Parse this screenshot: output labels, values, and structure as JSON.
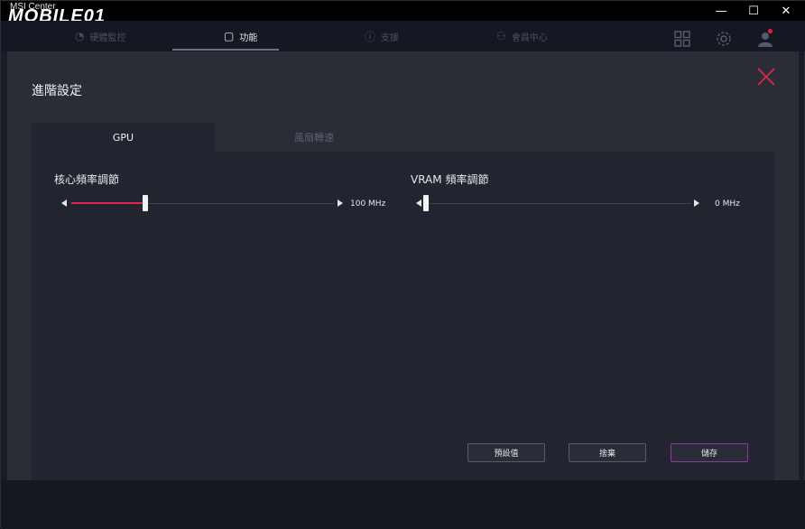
{
  "app": {
    "title": "MSI Center",
    "brand": "MOBILE01"
  },
  "window_controls": {
    "minimize": "—",
    "maximize": "☐",
    "close": "✕"
  },
  "nav": {
    "tabs": [
      {
        "label": "硬體監控",
        "icon": "gauge-icon"
      },
      {
        "label": "功能",
        "icon": "feature-icon"
      },
      {
        "label": "支援",
        "icon": "support-icon"
      },
      {
        "label": "會員中心",
        "icon": "member-icon"
      }
    ],
    "active_index": 1
  },
  "modal": {
    "title": "進階設定",
    "tabs": [
      "GPU",
      "風扇轉速"
    ],
    "active_tab": 0,
    "sliders": [
      {
        "label": "核心頻率調節",
        "value_text": "100 MHz",
        "fraction": 0.28
      },
      {
        "label": "VRAM 頻率調節",
        "value_text": "0 MHz",
        "fraction": 0.0
      }
    ],
    "buttons": {
      "default": "預設值",
      "discard": "捨棄",
      "save": "儲存"
    }
  },
  "colors": {
    "accent": "#e0284a",
    "save_border": "#8b3a9e"
  }
}
